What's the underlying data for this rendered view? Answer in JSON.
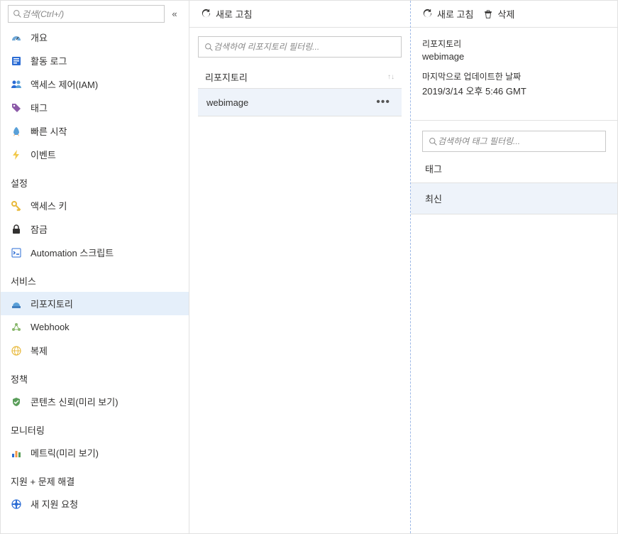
{
  "sidebar": {
    "search_placeholder": "검색(Ctrl+/)",
    "main_items": [
      {
        "icon": "gauge",
        "label": "개요",
        "color": "#6fa8d8"
      },
      {
        "icon": "log",
        "label": "활동 로그",
        "color": "#2b6cd4"
      },
      {
        "icon": "people",
        "label": "액세스 제어(IAM)",
        "color": "#2b6cd4"
      },
      {
        "icon": "tag",
        "label": "태그",
        "color": "#8c5aa8"
      },
      {
        "icon": "rocket",
        "label": "빠른 시작",
        "color": "#5aa0d8"
      },
      {
        "icon": "bolt",
        "label": "이벤트",
        "color": "#f2c94c"
      }
    ],
    "sections": [
      {
        "title": "설정",
        "items": [
          {
            "icon": "key",
            "label": "액세스 키",
            "color": "#e8b93c"
          },
          {
            "icon": "lock",
            "label": "잠금",
            "color": "#323130"
          },
          {
            "icon": "script",
            "label": "Automation 스크립트",
            "color": "#2b6cd4"
          }
        ]
      },
      {
        "title": "서비스",
        "items": [
          {
            "icon": "repo",
            "label": "리포지토리",
            "color": "#5aa0d8",
            "selected": true
          },
          {
            "icon": "webhook",
            "label": "Webhook",
            "color": "#8ab86e"
          },
          {
            "icon": "globe",
            "label": "복제",
            "color": "#e8b93c"
          }
        ]
      },
      {
        "title": "정책",
        "items": [
          {
            "icon": "shield",
            "label": "콘텐츠 신뢰(미리 보기)",
            "color": "#5a9e5a"
          }
        ]
      },
      {
        "title": "모니터링",
        "items": [
          {
            "icon": "chart",
            "label": "메트릭(미리 보기)",
            "color": "#2b6cd4"
          }
        ]
      },
      {
        "title": "지원 + 문제 해결",
        "items": [
          {
            "icon": "support",
            "label": "새 지원 요청",
            "color": "#2b6cd4"
          }
        ]
      }
    ]
  },
  "middle": {
    "toolbar": {
      "refresh": "새로 고침"
    },
    "filter_placeholder": "검색하여 리포지토리 필터링...",
    "column_header": "리포지토리",
    "repos": [
      {
        "name": "webimage"
      }
    ]
  },
  "right": {
    "toolbar": {
      "refresh": "새로 고침",
      "delete": "삭제"
    },
    "details": {
      "repo_label": "리포지토리",
      "repo_value": "webimage",
      "updated_label": "마지막으로 업데이트한 날짜",
      "updated_value": "2019/3/14 오후 5:46 GMT"
    },
    "tag_filter_placeholder": "검색하여 태그 필터링...",
    "tag_header": "태그",
    "tags": [
      {
        "name": "최신"
      }
    ]
  }
}
